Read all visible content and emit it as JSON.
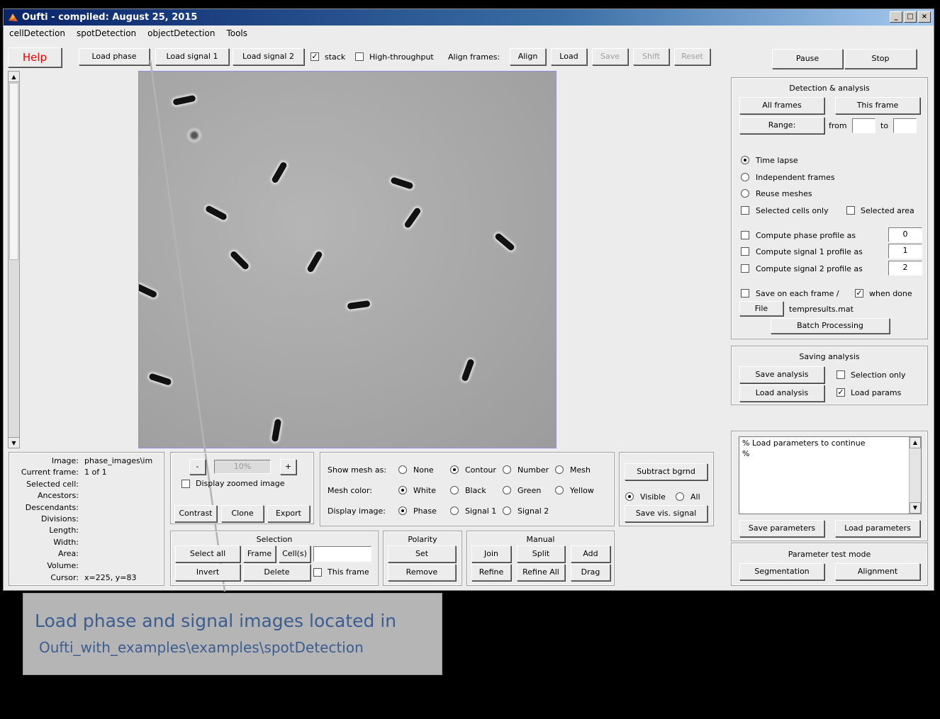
{
  "window": {
    "title": "Oufti - compiled:  August 25, 2015",
    "min": "_",
    "max": "□",
    "close": "×"
  },
  "menu": [
    "cellDetection",
    "spotDetection",
    "objectDetection",
    "Tools"
  ],
  "toolbar": {
    "help": "Help",
    "load_phase": "Load phase",
    "load_signal1": "Load signal 1",
    "load_signal2": "Load signal 2",
    "stack": "stack",
    "high_throughput": "High-throughput",
    "align_frames": "Align frames:",
    "align": "Align",
    "load": "Load",
    "save": "Save",
    "shift": "Shift",
    "reset": "Reset",
    "pause": "Pause",
    "stop": "Stop"
  },
  "info": {
    "image_label": "Image:",
    "image_value": "phase_images\\im",
    "current_frame_label": "Current frame:",
    "current_frame_value": "1 of 1",
    "selected_cell_label": "Selected cell:",
    "ancestors_label": "Ancestors:",
    "descendants_label": "Descendants:",
    "divisions_label": "Divisions:",
    "length_label": "Length:",
    "width_label": "Width:",
    "area_label": "Area:",
    "volume_label": "Volume:",
    "cursor_label": "Cursor:",
    "cursor_value": "x=225, y=83"
  },
  "zoom": {
    "minus": "-",
    "value": "10%",
    "plus": "+",
    "display_zoomed": "Display zoomed image",
    "contrast": "Contrast",
    "clone": "Clone",
    "export": "Export"
  },
  "display": {
    "show_mesh_label": "Show mesh as:",
    "mesh_none": "None",
    "mesh_contour": "Contour",
    "mesh_number": "Number",
    "mesh_mesh": "Mesh",
    "mesh_color_label": "Mesh color:",
    "white": "White",
    "black": "Black",
    "green": "Green",
    "yellow": "Yellow",
    "display_image_label": "Display image:",
    "phase": "Phase",
    "signal1": "Signal 1",
    "signal2": "Signal 2"
  },
  "bgrnd": {
    "subtract": "Subtract bgrnd",
    "visible": "Visible",
    "all": "All",
    "save_vis": "Save vis. signal"
  },
  "selection": {
    "title": "Selection",
    "select_all": "Select all",
    "frame": "Frame",
    "cells": "Cell(s)",
    "invert": "Invert",
    "delete": "Delete",
    "this_frame": "This frame"
  },
  "polarity": {
    "title": "Polarity",
    "set": "Set",
    "remove": "Remove"
  },
  "manual": {
    "title": "Manual",
    "join": "Join",
    "split": "Split",
    "add": "Add",
    "refine": "Refine",
    "refine_all": "Refine All",
    "drag": "Drag"
  },
  "detection": {
    "title": "Detection & analysis",
    "all_frames": "All frames",
    "this_frame": "This frame",
    "range": "Range:",
    "from": "from",
    "to": "to",
    "time_lapse": "Time lapse",
    "independent": "Independent frames",
    "reuse": "Reuse meshes",
    "selected_cells": "Selected cells only",
    "selected_area": "Selected area",
    "phase_profile": "Compute phase profile as",
    "phase_profile_val": "0",
    "signal1_profile": "Compute signal 1 profile as",
    "signal1_profile_val": "1",
    "signal2_profile": "Compute signal 2 profile as",
    "signal2_profile_val": "2",
    "save_each": "Save on each frame /",
    "when_done": "when done",
    "file": "File",
    "filename": "tempresults.mat",
    "batch": "Batch Processing"
  },
  "saving": {
    "title": "Saving analysis",
    "save": "Save analysis",
    "selection_only": "Selection only",
    "load": "Load analysis",
    "load_params": "Load params"
  },
  "params": {
    "line1": "% Load parameters to continue",
    "line2": "%",
    "save": "Save parameters",
    "load": "Load parameters"
  },
  "test_mode": {
    "title": "Parameter test mode",
    "segmentation": "Segmentation",
    "alignment": "Alignment"
  },
  "callout": {
    "line1": "Load phase and signal images located in",
    "line2": "Oufti_with_examples\\examples\\spotDetection"
  }
}
